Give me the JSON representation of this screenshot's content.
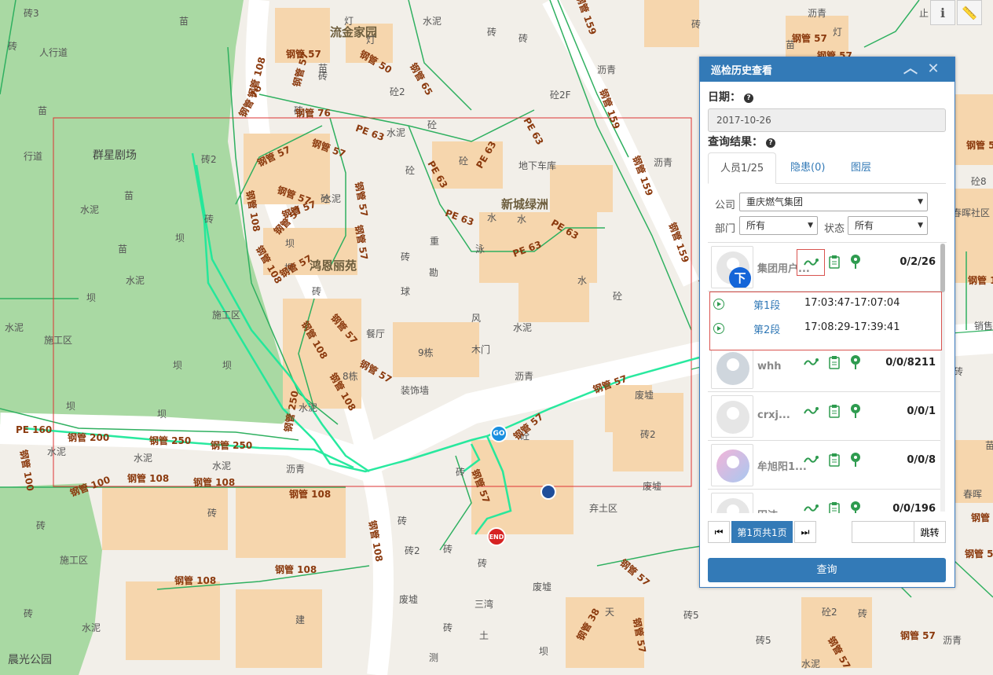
{
  "map": {
    "pois": [
      "流金家园",
      "新城绿洲",
      "鸿恩丽苑",
      "群星剧场",
      "晨光公园"
    ],
    "labels": [
      "砖3",
      "苗",
      "灯",
      "水泥",
      "砖",
      "砖",
      "人行道",
      "苗",
      "灯",
      "砖",
      "砼2",
      "砖",
      "沥青",
      "苗",
      "砖",
      "水泥",
      "砼",
      "苗",
      "砼2F",
      "砼",
      "苗",
      "水泥",
      "砼",
      "地下车库",
      "沥青",
      "行道",
      "砖2",
      "砼",
      "水泥",
      "砖",
      "坝",
      "重",
      "砖",
      "泳",
      "水",
      "水",
      "坝",
      "坝",
      "勘",
      "水泥",
      "砖",
      "水",
      "砼",
      "坝",
      "施工区",
      "水泥",
      "坝",
      "球",
      "风",
      "水泥",
      "施工区",
      "餐厅",
      "9栋",
      "木门",
      "坝",
      "8栋",
      "沥青",
      "装饰墙",
      "废墟",
      "坝",
      "坝",
      "水泥",
      "砖2",
      "砼",
      "水泥",
      "水泥",
      "水泥",
      "沥青",
      "砖",
      "废墟",
      "弃土区",
      "砖",
      "砖2",
      "砖",
      "砖",
      "废墟",
      "施工区",
      "砖",
      "砖",
      "三湾",
      "废墟",
      "水泥",
      "砖",
      "砖",
      "建",
      "土",
      "测",
      "坝",
      "天",
      "砖5",
      "砖5",
      "水泥",
      "砼2",
      "砖",
      "砼8",
      "坝",
      "春晖社区",
      "苗",
      "沥青",
      "春晖",
      "砖",
      "销售公司",
      "砖",
      "沥青",
      "止",
      "灯",
      "苗",
      "水"
    ],
    "pipes": [
      "钢管 108",
      "钢管 57",
      "钢管 57",
      "钢管 50",
      "钢管 65",
      "钢管 76",
      "钢管 76",
      "钢管 57",
      "钢管 57",
      "PE 63",
      "钢管 108",
      "钢管 57",
      "钢管 57",
      "钢管 57",
      "钢管 57",
      "PE 63",
      "PE 63",
      "PE 63",
      "钢管 57",
      "钢管 57",
      "钢管 108",
      "钢管 108",
      "钢管 57",
      "钢管 57",
      "钢管 108",
      "钢管 57",
      "钢管 159",
      "钢管 159",
      "钢管 159",
      "钢管 159",
      "钢管 159",
      "PE 63",
      "PE 63",
      "PE 63",
      "PE 160",
      "钢管 200",
      "钢管 250",
      "钢管 250",
      "钢管 250",
      "钢管 100",
      "钢管 100",
      "钢管 108",
      "钢管 108",
      "钢管 108",
      "钢管 108",
      "钢管 108",
      "钢管 108",
      "钢管 57",
      "钢管 57",
      "钢管 38",
      "钢管 57",
      "钢管 57",
      "钢管 57",
      "钢管 57",
      "钢管 57",
      "钢管 108",
      "钢管 57",
      "钢管 57",
      "钢管 57",
      "钢管 57"
    ],
    "markers": {
      "start": "GO",
      "end": "END",
      "user": "下"
    },
    "tools": {
      "info": "ℹ",
      "measure": "📏"
    }
  },
  "panel": {
    "title": "巡检历史查看",
    "date_label": "日期：",
    "date_value": "2017-10-26",
    "result_label": "查询结果：",
    "tabs": [
      "人员1/25",
      "隐患(0)",
      "图层"
    ],
    "company_label": "公司",
    "company_value": "重庆燃气集团",
    "dept_label": "部门",
    "dept_value": "所有",
    "status_label": "状态",
    "status_value": "所有",
    "users": [
      {
        "name": "集团用户...",
        "stats": "0/2/26"
      },
      {
        "name": "whh",
        "stats": "0/0/8211"
      },
      {
        "name": "crxj...",
        "stats": "0/0/1"
      },
      {
        "name": "牟旭阳1...",
        "stats": "0/0/8"
      },
      {
        "name": "田洁",
        "stats": "0/0/196"
      }
    ],
    "segments": [
      {
        "name": "第1段",
        "time": "17:03:47-17:07:04"
      },
      {
        "name": "第2段",
        "time": "17:08:29-17:39:41"
      }
    ],
    "pager": {
      "first": "⏮",
      "page_text": "第1页共1页",
      "last": "⏭",
      "jump_label": "跳转",
      "jump_value": ""
    },
    "query_label": "查询"
  },
  "colors": {
    "accent": "#337ab7",
    "pipe": "#8b3a0e",
    "track": "#1ee89a",
    "park": "#a8d8a0"
  }
}
